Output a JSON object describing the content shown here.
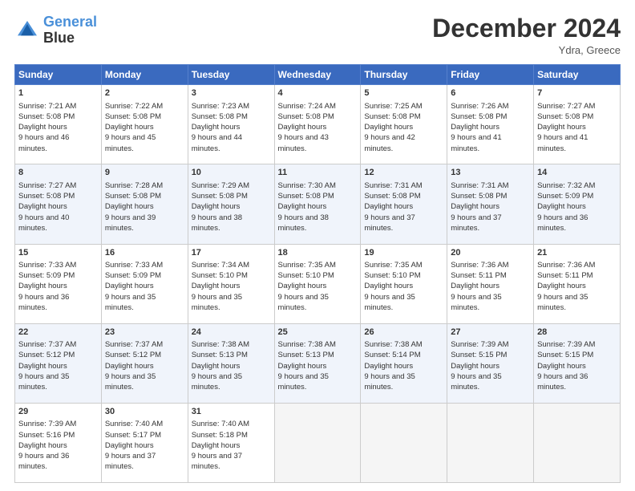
{
  "header": {
    "logo_line1": "General",
    "logo_line2": "Blue",
    "title": "December 2024",
    "location": "Ydra, Greece"
  },
  "days_of_week": [
    "Sunday",
    "Monday",
    "Tuesday",
    "Wednesday",
    "Thursday",
    "Friday",
    "Saturday"
  ],
  "weeks": [
    [
      {
        "day": "1",
        "rise": "7:21 AM",
        "set": "5:08 PM",
        "hours": "9 hours and 46 minutes."
      },
      {
        "day": "2",
        "rise": "7:22 AM",
        "set": "5:08 PM",
        "hours": "9 hours and 45 minutes."
      },
      {
        "day": "3",
        "rise": "7:23 AM",
        "set": "5:08 PM",
        "hours": "9 hours and 44 minutes."
      },
      {
        "day": "4",
        "rise": "7:24 AM",
        "set": "5:08 PM",
        "hours": "9 hours and 43 minutes."
      },
      {
        "day": "5",
        "rise": "7:25 AM",
        "set": "5:08 PM",
        "hours": "9 hours and 42 minutes."
      },
      {
        "day": "6",
        "rise": "7:26 AM",
        "set": "5:08 PM",
        "hours": "9 hours and 41 minutes."
      },
      {
        "day": "7",
        "rise": "7:27 AM",
        "set": "5:08 PM",
        "hours": "9 hours and 41 minutes."
      }
    ],
    [
      {
        "day": "8",
        "rise": "7:27 AM",
        "set": "5:08 PM",
        "hours": "9 hours and 40 minutes."
      },
      {
        "day": "9",
        "rise": "7:28 AM",
        "set": "5:08 PM",
        "hours": "9 hours and 39 minutes."
      },
      {
        "day": "10",
        "rise": "7:29 AM",
        "set": "5:08 PM",
        "hours": "9 hours and 38 minutes."
      },
      {
        "day": "11",
        "rise": "7:30 AM",
        "set": "5:08 PM",
        "hours": "9 hours and 38 minutes."
      },
      {
        "day": "12",
        "rise": "7:31 AM",
        "set": "5:08 PM",
        "hours": "9 hours and 37 minutes."
      },
      {
        "day": "13",
        "rise": "7:31 AM",
        "set": "5:08 PM",
        "hours": "9 hours and 37 minutes."
      },
      {
        "day": "14",
        "rise": "7:32 AM",
        "set": "5:09 PM",
        "hours": "9 hours and 36 minutes."
      }
    ],
    [
      {
        "day": "15",
        "rise": "7:33 AM",
        "set": "5:09 PM",
        "hours": "9 hours and 36 minutes."
      },
      {
        "day": "16",
        "rise": "7:33 AM",
        "set": "5:09 PM",
        "hours": "9 hours and 35 minutes."
      },
      {
        "day": "17",
        "rise": "7:34 AM",
        "set": "5:10 PM",
        "hours": "9 hours and 35 minutes."
      },
      {
        "day": "18",
        "rise": "7:35 AM",
        "set": "5:10 PM",
        "hours": "9 hours and 35 minutes."
      },
      {
        "day": "19",
        "rise": "7:35 AM",
        "set": "5:10 PM",
        "hours": "9 hours and 35 minutes."
      },
      {
        "day": "20",
        "rise": "7:36 AM",
        "set": "5:11 PM",
        "hours": "9 hours and 35 minutes."
      },
      {
        "day": "21",
        "rise": "7:36 AM",
        "set": "5:11 PM",
        "hours": "9 hours and 35 minutes."
      }
    ],
    [
      {
        "day": "22",
        "rise": "7:37 AM",
        "set": "5:12 PM",
        "hours": "9 hours and 35 minutes."
      },
      {
        "day": "23",
        "rise": "7:37 AM",
        "set": "5:12 PM",
        "hours": "9 hours and 35 minutes."
      },
      {
        "day": "24",
        "rise": "7:38 AM",
        "set": "5:13 PM",
        "hours": "9 hours and 35 minutes."
      },
      {
        "day": "25",
        "rise": "7:38 AM",
        "set": "5:13 PM",
        "hours": "9 hours and 35 minutes."
      },
      {
        "day": "26",
        "rise": "7:38 AM",
        "set": "5:14 PM",
        "hours": "9 hours and 35 minutes."
      },
      {
        "day": "27",
        "rise": "7:39 AM",
        "set": "5:15 PM",
        "hours": "9 hours and 35 minutes."
      },
      {
        "day": "28",
        "rise": "7:39 AM",
        "set": "5:15 PM",
        "hours": "9 hours and 36 minutes."
      }
    ],
    [
      {
        "day": "29",
        "rise": "7:39 AM",
        "set": "5:16 PM",
        "hours": "9 hours and 36 minutes."
      },
      {
        "day": "30",
        "rise": "7:40 AM",
        "set": "5:17 PM",
        "hours": "9 hours and 37 minutes."
      },
      {
        "day": "31",
        "rise": "7:40 AM",
        "set": "5:18 PM",
        "hours": "9 hours and 37 minutes."
      },
      null,
      null,
      null,
      null
    ]
  ]
}
